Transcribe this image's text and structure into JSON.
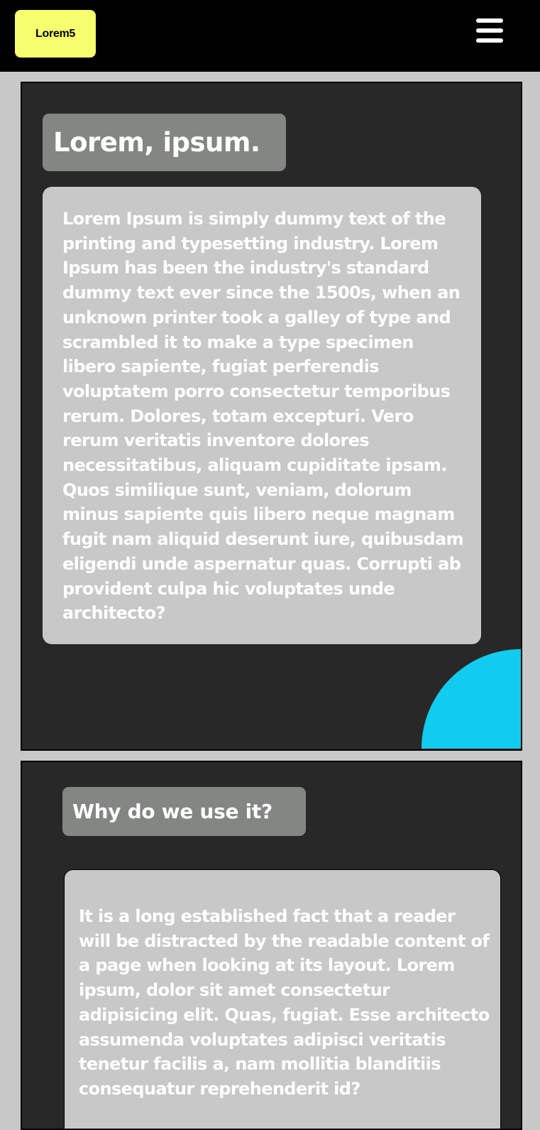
{
  "header": {
    "logo_label": "Lorem5",
    "menu_icon": "hamburger-menu-icon"
  },
  "colors": {
    "header_bg": "#000000",
    "logo_bg": "#f7ff6e",
    "page_bg": "#c8c8c8",
    "card_bg": "#282828",
    "heading_bg": "#848684",
    "text_box_bg": "#c8c8c8",
    "accent_shape": "#11ccee"
  },
  "sections": [
    {
      "title": "Lorem, ipsum.",
      "body": "Lorem Ipsum is simply dummy text of the printing and typesetting industry. Lorem Ipsum has been the industry's standard dummy text ever since the 1500s, when an unknown printer took a galley of type and scrambled it to make a type specimen libero sapiente, fugiat perferendis voluptatem porro consectetur temporibus rerum. Dolores, totam excepturi. Vero rerum veritatis inventore dolores necessitatibus, aliquam cupiditate ipsam. Quos similique sunt, veniam, dolorum minus sapiente quis libero neque magnam fugit nam aliquid deserunt iure, quibusdam eligendi unde aspernatur quas. Corrupti ab provident culpa hic voluptates unde architecto?"
    },
    {
      "title": "Why do we use it?",
      "body": "It is a long established fact that a reader will be distracted by the readable content of a page when looking at its layout. Lorem ipsum, dolor sit amet consectetur adipisicing elit. Quas, fugiat. Esse architecto assumenda voluptates adipisci veritatis tenetur facilis a, nam mollitia blanditiis consequatur reprehenderit id?"
    }
  ]
}
